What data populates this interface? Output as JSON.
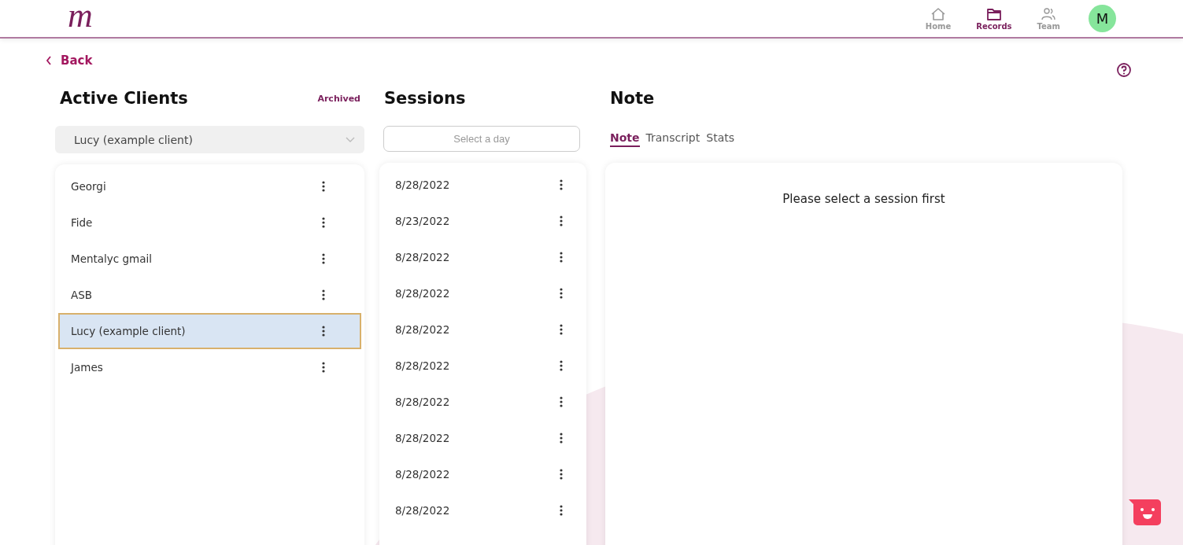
{
  "header": {
    "logo": "m",
    "nav": [
      {
        "label": "Home",
        "kind": "home",
        "selected": false
      },
      {
        "label": "Records",
        "kind": "records",
        "selected": true
      },
      {
        "label": "Team",
        "kind": "team",
        "selected": false
      }
    ],
    "avatar": "M"
  },
  "back": "Back",
  "clients": {
    "title": "Active Clients",
    "archived_link": "Archived",
    "dropdown": "Lucy (example client)",
    "items": [
      {
        "name": "Georgi",
        "selected": false
      },
      {
        "name": "Fide",
        "selected": false
      },
      {
        "name": "Mentalyc gmail",
        "selected": false
      },
      {
        "name": "ASB",
        "selected": false
      },
      {
        "name": "Lucy (example client)",
        "selected": true
      },
      {
        "name": "James",
        "selected": false
      }
    ]
  },
  "sessions": {
    "title": "Sessions",
    "date_placeholder": "Select a day",
    "items": [
      "8/28/2022",
      "8/23/2022",
      "8/28/2022",
      "8/28/2022",
      "8/28/2022",
      "8/28/2022",
      "8/28/2022",
      "8/28/2022",
      "8/28/2022",
      "8/28/2022"
    ]
  },
  "note": {
    "title": "Note",
    "tabs": [
      {
        "label": "Note",
        "selected": true
      },
      {
        "label": "Transcript",
        "selected": false
      },
      {
        "label": "Stats",
        "selected": false
      }
    ],
    "empty_message": "Please select a session first"
  }
}
